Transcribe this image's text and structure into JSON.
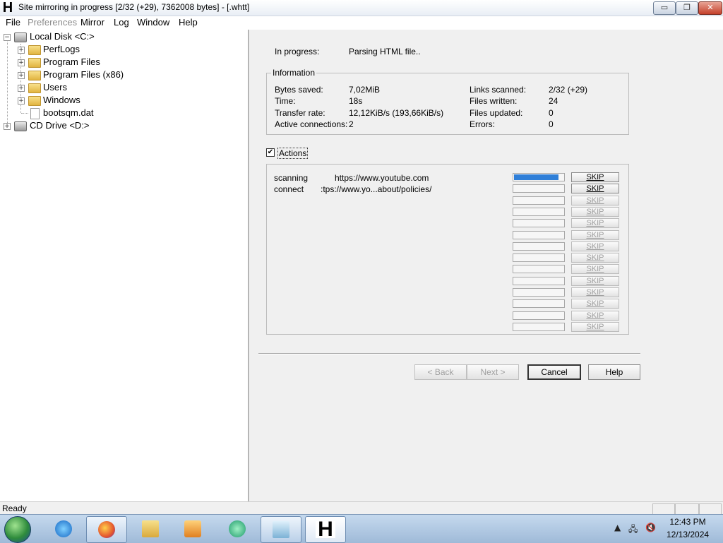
{
  "window": {
    "title": "Site mirroring in progress [2/32 (+29), 7362008 bytes] - [.whtt]",
    "app_icon_letter": "H",
    "controls": {
      "minimize": "▭",
      "maximize": "❐",
      "close": "✕"
    }
  },
  "menu": [
    "File",
    "Preferences",
    "Mirror",
    "Log",
    "Window",
    "Help"
  ],
  "tree": {
    "local_disk": "Local Disk <C:>",
    "folders": [
      "PerfLogs",
      "Program Files",
      "Program Files (x86)",
      "Users",
      "Windows"
    ],
    "file": "bootsqm.dat",
    "cd_drive": "CD Drive <D:>"
  },
  "progress_status": {
    "label": "In progress:",
    "value": "Parsing HTML file.."
  },
  "information": {
    "title": "Information",
    "left": [
      {
        "label": "Bytes saved:",
        "value": "7,02MiB"
      },
      {
        "label": "Time:",
        "value": "18s"
      },
      {
        "label": "Transfer rate:",
        "value": "12,12KiB/s (193,66KiB/s)"
      },
      {
        "label": "Active connections:",
        "value": "2"
      }
    ],
    "right": [
      {
        "label": "Links scanned:",
        "value": "2/32 (+29)"
      },
      {
        "label": "Files written:",
        "value": "24"
      },
      {
        "label": "Files updated:",
        "value": "0"
      },
      {
        "label": "Errors:",
        "value": "0"
      }
    ]
  },
  "actions": {
    "checkbox_label": "Actions",
    "checked": true,
    "rows": [
      {
        "status": "scanning",
        "url": "https://www.youtube.com",
        "progress": 0.9
      },
      {
        "status": "connect",
        "url": ":tps://www.yo...about/policies/",
        "progress": 0
      }
    ],
    "skip_label": "SKIP",
    "slots": 14
  },
  "buttons": {
    "back": "< Back",
    "next": "Next >",
    "cancel": "Cancel",
    "help": "Help"
  },
  "statusbar": {
    "text": "Ready"
  },
  "taskbar": {
    "time": "12:43 PM",
    "date": "12/13/2024",
    "apps": [
      "internet-explorer",
      "firefox",
      "file-explorer",
      "media-player",
      "app-green",
      "notepad",
      "httrack"
    ]
  },
  "colors": {
    "progress_fill": "#2f7fd8",
    "titlebar_close": "#c4402a"
  }
}
